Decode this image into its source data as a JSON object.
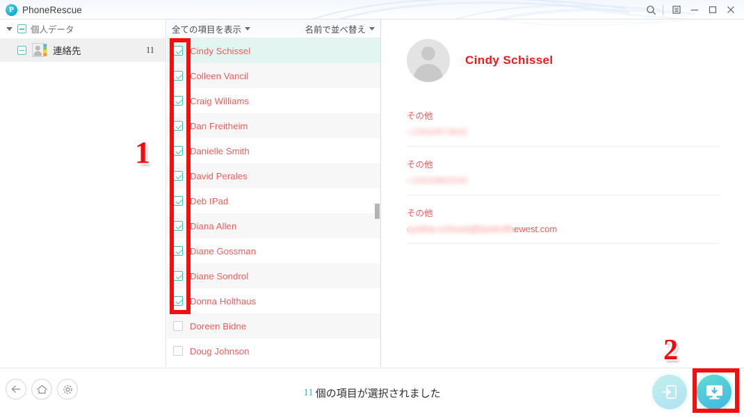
{
  "window": {
    "app_title": "PhoneRescue",
    "logo_letter": "P",
    "logo_icon": "phonerescue-logo-icon",
    "controls": {
      "search_icon": "search-icon",
      "menu_icon": "menu-icon",
      "minimize_icon": "minimize-icon",
      "maximize_icon": "maximize-icon",
      "close_icon": "close-icon"
    }
  },
  "sidebar": {
    "group": {
      "label": "個人データ",
      "caret_icon": "chevron-down-icon",
      "checkbox_state": "indeterminate"
    },
    "items": [
      {
        "label": "連絡先",
        "count": "11",
        "icon": "contacts-icon",
        "checkbox_state": "indeterminate",
        "selected": true
      }
    ]
  },
  "list": {
    "header": {
      "filter_label": "全ての項目を表示",
      "filter_caret_icon": "chevron-down-icon",
      "sort_label": "名前で並べ替え",
      "sort_caret_icon": "chevron-down-icon"
    },
    "rows": [
      {
        "name": "Cindy  Schissel",
        "checked": true,
        "selected": true
      },
      {
        "name": "Colleen  Vancil",
        "checked": true,
        "selected": false
      },
      {
        "name": "Craig  Williams",
        "checked": true,
        "selected": false
      },
      {
        "name": "Dan  Freitheim",
        "checked": true,
        "selected": false
      },
      {
        "name": "Danielle  Smith",
        "checked": true,
        "selected": false
      },
      {
        "name": "David  Perales",
        "checked": true,
        "selected": false
      },
      {
        "name": "Deb  IPad",
        "checked": true,
        "selected": false
      },
      {
        "name": "Diana  Allen",
        "checked": true,
        "selected": false
      },
      {
        "name": "Diane  Gossman",
        "checked": true,
        "selected": false
      },
      {
        "name": "Diane  Sondrol",
        "checked": true,
        "selected": false
      },
      {
        "name": "Donna Holthaus",
        "checked": true,
        "selected": false
      },
      {
        "name": "Doreen  Bidne",
        "checked": false,
        "selected": false
      },
      {
        "name": "Doug  Johnson",
        "checked": false,
        "selected": false
      }
    ],
    "scrollbar": {
      "name": "list-scrollbar"
    }
  },
  "detail": {
    "avatar_icon": "avatar-placeholder-icon",
    "name": "Cindy  Schissel",
    "fields": [
      {
        "label": "その他",
        "value": "+15632873640",
        "redacted": "full"
      },
      {
        "label": "その他",
        "value": "+15633862040",
        "redacted": "full"
      },
      {
        "label": "その他",
        "value": "cynthia.schissel@bankofthewest.com",
        "redacted": "partial"
      }
    ]
  },
  "bottom": {
    "nav": [
      {
        "label_icon": "back-arrow-icon"
      },
      {
        "label_icon": "home-icon"
      },
      {
        "label_icon": "gear-icon"
      }
    ],
    "status_count": "11",
    "status_text": "個の項目が選択されました",
    "actions": [
      {
        "icon": "restore-to-device-icon",
        "enabled": false
      },
      {
        "icon": "recover-to-computer-icon",
        "enabled": true
      }
    ]
  },
  "annotations": [
    {
      "number": "1",
      "target": "checkbox-column"
    },
    {
      "number": "2",
      "target": "recover-to-computer-button"
    }
  ],
  "colors": {
    "brand_teal": "#3fc2b2",
    "name_red": "#ef5c5c",
    "detail_name_red": "#ef1a1a",
    "annotation_red": "#f60d0d",
    "selected_row": "#e3f5f1",
    "alt_row": "#f7f7f7"
  }
}
